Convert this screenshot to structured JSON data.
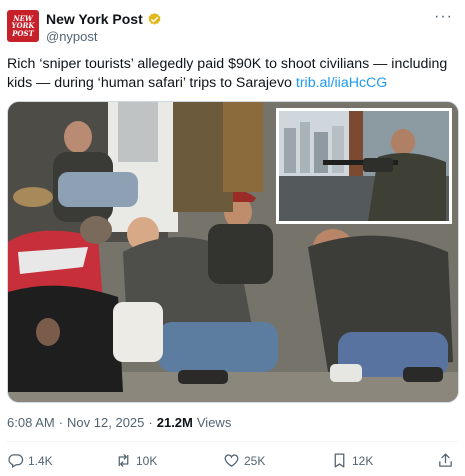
{
  "account": {
    "display_name": "New York Post",
    "handle": "@nypost",
    "avatar_line1": "NEW",
    "avatar_line2": "YORK",
    "avatar_line3": "POST"
  },
  "tweet": {
    "text": "Rich ‘sniper tourists’ allegedly paid $90K to shoot civilians — including kids — during ‘human safari’ trips to Sarajevo ",
    "link": "trib.al/iiaHcCG",
    "time": "6:08 AM",
    "date": "Nov 12, 2025",
    "separator": "·",
    "views_count": "21.2M",
    "views_label": "Views"
  },
  "actions": {
    "replies": "1.4K",
    "reposts": "10K",
    "likes": "25K",
    "bookmarks": "12K"
  },
  "colors": {
    "brand_red": "#c6202b",
    "verified_gold": "#e2b719",
    "link_blue": "#1d9bf0",
    "secondary_text": "#536471"
  }
}
